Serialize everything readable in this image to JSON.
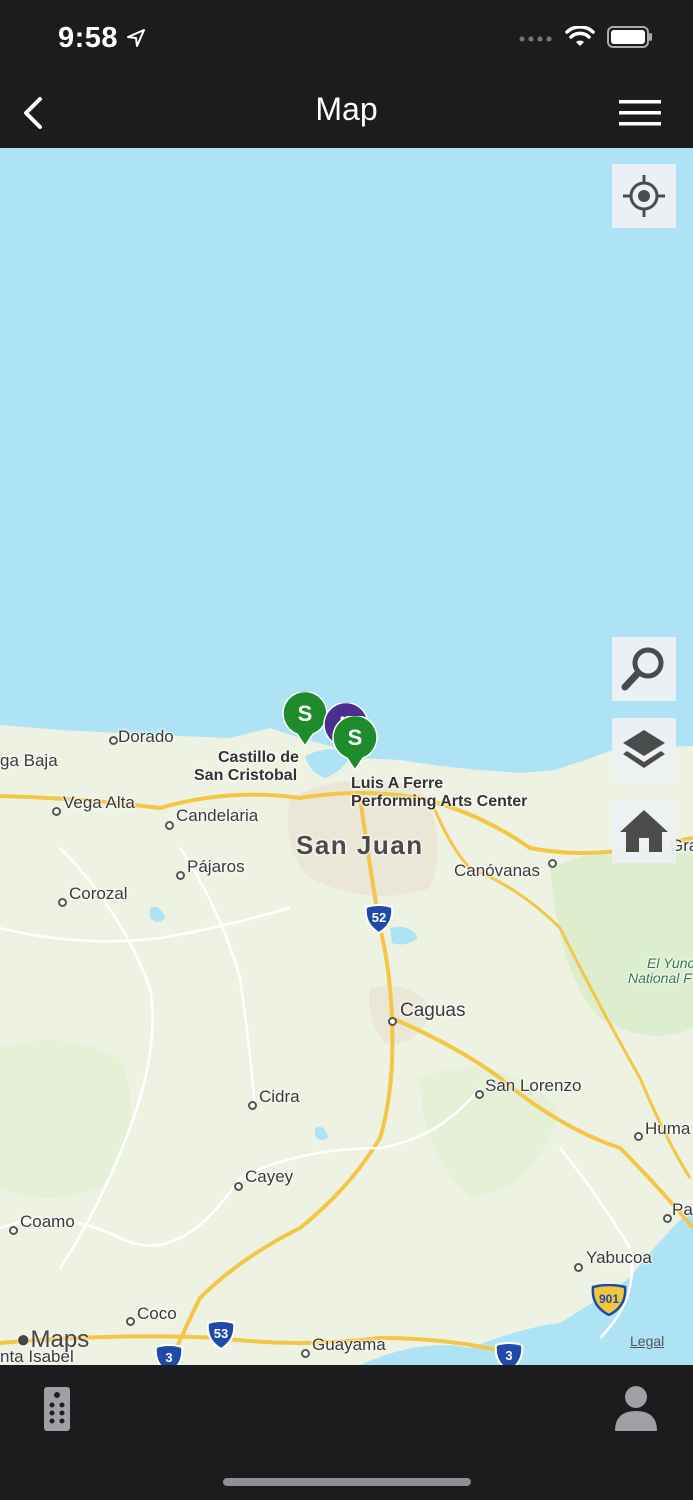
{
  "status": {
    "time": "9:58",
    "location_icon": "location-arrow-icon",
    "cellular_icon": "cellular-signal-icon",
    "wifi_icon": "wifi-icon",
    "battery_icon": "battery-icon"
  },
  "nav": {
    "title": "Map",
    "back_icon": "chevron-left-icon",
    "menu_icon": "hamburger-menu-icon"
  },
  "map": {
    "labels": {
      "dorado": "Dorado",
      "vega_baja": "ga Baja",
      "vega_alta": "Vega Alta",
      "castillo_line1": "Castillo de",
      "castillo_line2": "San Cristobal",
      "luis_line1": "Luis A Ferre",
      "luis_line2": "Performing Arts Center",
      "candelaria": "Candelaria",
      "san_juan": "San Juan",
      "pajaros": "Pájaros",
      "canovanas": "Canóvanas",
      "gra": "Gra",
      "corozal": "Corozal",
      "yunque_line1": "El Yunc",
      "yunque_line2": "National F",
      "caguas": "Caguas",
      "san_lorenzo": "San Lorenzo",
      "cidra": "Cidra",
      "huma": "Huma",
      "cayey": "Cayey",
      "pa": "Pa",
      "coamo": "Coamo",
      "yabucoa": "Yabucoa",
      "coco": "Coco",
      "guayama": "Guayama",
      "santa_isabel": "nta Isabel"
    },
    "highway_shields": {
      "h52": "52",
      "h53": "53",
      "h3_left": "3",
      "h3_right": "3",
      "h901": "901"
    },
    "pins": [
      {
        "label": "S",
        "color": "#1e8c2b"
      },
      {
        "label": "L",
        "color": "#4b2f8f"
      },
      {
        "label": "S",
        "color": "#1e8c2b"
      }
    ],
    "controls": {
      "locate_icon": "crosshair-locate-icon",
      "search_icon": "search-icon",
      "layers_icon": "layers-icon",
      "home_icon": "home-icon"
    },
    "attribution": "Maps",
    "legal": "Legal"
  },
  "tab_bar": {
    "left_icon": "remote-control-icon",
    "right_icon": "user-profile-icon"
  },
  "colors": {
    "water": "#aee3f5",
    "land": "#eef2e2",
    "highway": "#f3c646",
    "chrome": "#1c1c1e"
  }
}
